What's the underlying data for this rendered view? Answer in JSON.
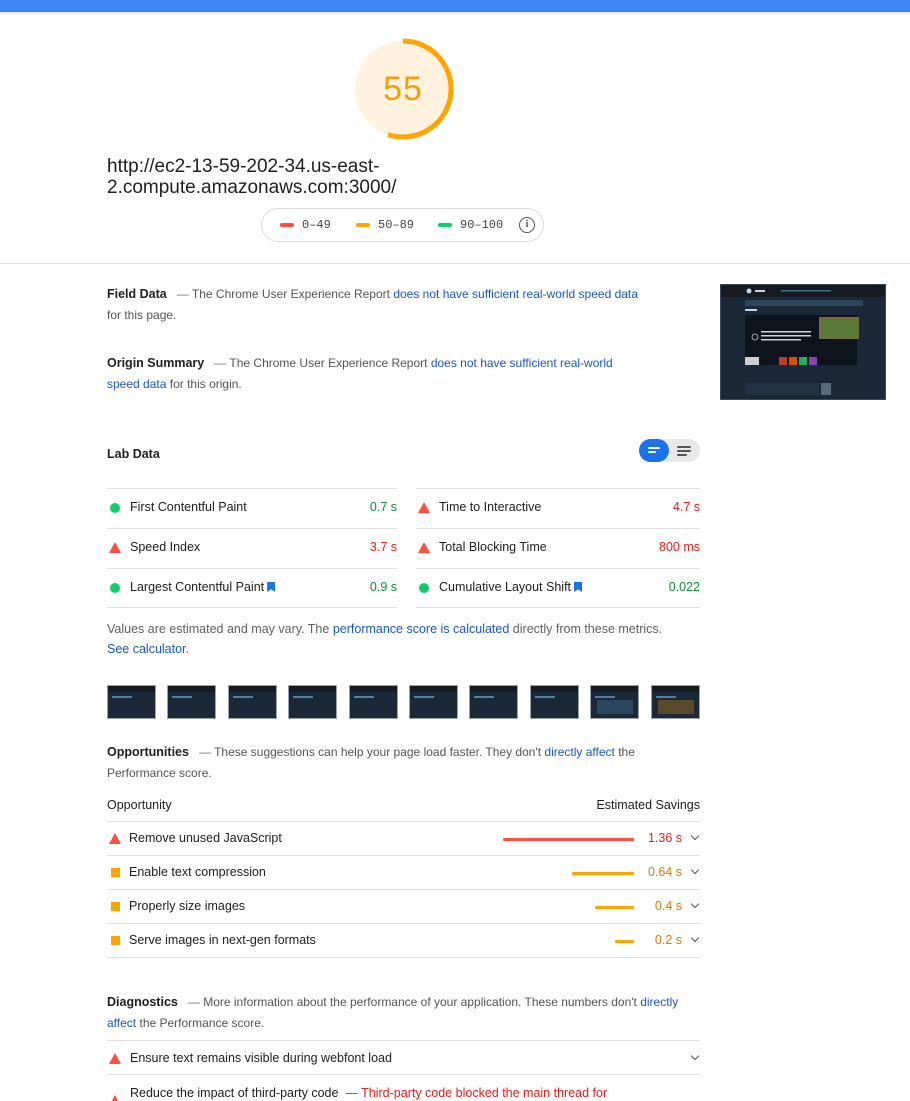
{
  "header": {
    "accent": "#4285f4"
  },
  "score": {
    "value": "55",
    "fraction": 0.55,
    "color": "#f59e0b"
  },
  "url": "http://ec2-13-59-202-34.us-east-2.compute.amazonaws.com:3000/",
  "legend": {
    "items": [
      {
        "label": "0–49",
        "color": "#ff4e42"
      },
      {
        "label": "50–89",
        "color": "#ffa400"
      },
      {
        "label": "90–100",
        "color": "#0cce6b"
      }
    ],
    "info_icon": "info-icon"
  },
  "field_data": {
    "title": "Field Data",
    "dash": "—",
    "pre": "The Chrome User Experience Report",
    "link": "does not have sufficient real-world speed data",
    "post": "for this page."
  },
  "origin_summary": {
    "title": "Origin Summary",
    "dash": "—",
    "pre": "The Chrome User Experience Report",
    "link": "does not have sufficient real-world speed data",
    "post": "for this origin."
  },
  "lab_data": {
    "title": "Lab Data",
    "metrics_left": [
      {
        "name": "First Contentful Paint",
        "value": "0.7 s",
        "status": "good",
        "bookmark": false
      },
      {
        "name": "Speed Index",
        "value": "3.7 s",
        "status": "bad",
        "bookmark": false
      },
      {
        "name": "Largest Contentful Paint",
        "value": "0.9 s",
        "status": "good",
        "bookmark": true
      }
    ],
    "metrics_right": [
      {
        "name": "Time to Interactive",
        "value": "4.7 s",
        "status": "bad",
        "bookmark": false
      },
      {
        "name": "Total Blocking Time",
        "value": "800 ms",
        "status": "bad",
        "bookmark": false
      },
      {
        "name": "Cumulative Layout Shift",
        "value": "0.022",
        "status": "good",
        "bookmark": true
      }
    ],
    "note": {
      "pre": "Values are estimated and may vary. The",
      "link1": "performance score is calculated",
      "mid": "directly from these metrics.",
      "link2": "See calculator",
      "post": "."
    }
  },
  "filmstrip": {
    "frames": 10
  },
  "opportunities": {
    "title": "Opportunities",
    "dash": "—",
    "pre": "These suggestions can help your page load faster. They don't",
    "link": "directly affect",
    "post": "the Performance score.",
    "col_opportunity": "Opportunity",
    "col_savings": "Estimated Savings",
    "items": [
      {
        "name": "Remove unused JavaScript",
        "value": "1.36 s",
        "seconds": 1.36,
        "status": "bad"
      },
      {
        "name": "Enable text compression",
        "value": "0.64 s",
        "seconds": 0.64,
        "status": "average"
      },
      {
        "name": "Properly size images",
        "value": "0.4 s",
        "seconds": 0.4,
        "status": "average"
      },
      {
        "name": "Serve images in next-gen formats",
        "value": "0.2 s",
        "seconds": 0.2,
        "status": "average"
      }
    ]
  },
  "diagnostics": {
    "title": "Diagnostics",
    "dash": "—",
    "pre": "More information about the performance of your application. These numbers don't",
    "link": "directly affect",
    "post": "the Performance score.",
    "items": [
      {
        "name": "Ensure text remains visible during webfont load",
        "note": ""
      },
      {
        "name": "Reduce the impact of third-party code",
        "note": "— Third-party code blocked the main thread for"
      }
    ]
  }
}
